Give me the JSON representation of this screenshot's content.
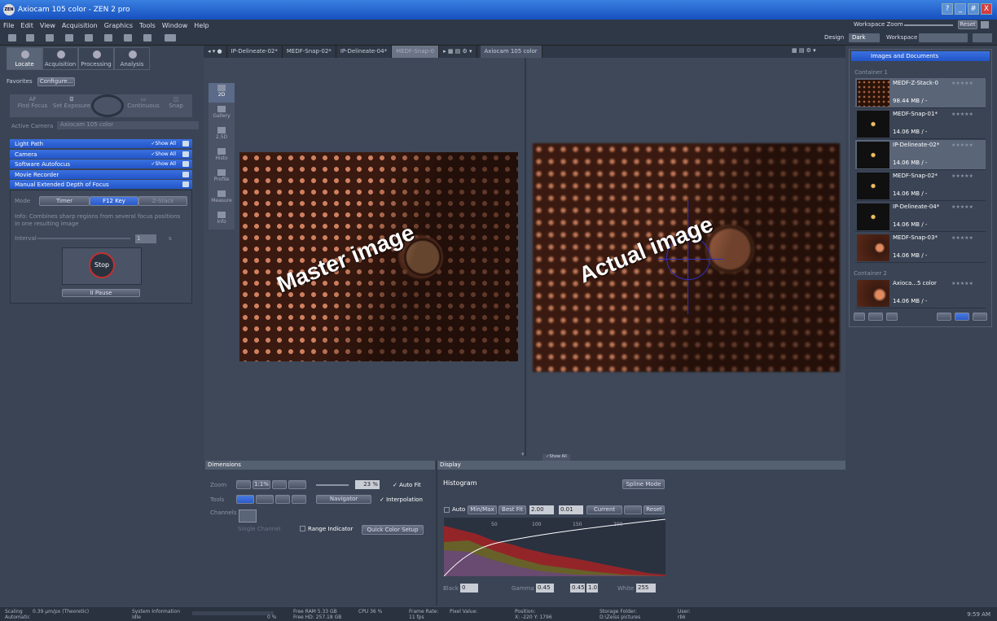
{
  "app": {
    "title": "Axiocam 105 color - ZEN 2 pro",
    "logo": "ZEN",
    "window_buttons": [
      "?",
      "_",
      "#",
      "X"
    ]
  },
  "menu": [
    "File",
    "Edit",
    "View",
    "Acquisition",
    "Graphics",
    "Tools",
    "Window",
    "Help"
  ],
  "top_right": {
    "workspace_zoom": "Workspace Zoom",
    "reset": "Reset",
    "design_label": "Design",
    "design_value": "Dark",
    "workspace_label": "Workspace"
  },
  "left": {
    "tabs": [
      "Locate",
      "Acquisition",
      "Processing",
      "Analysis"
    ],
    "favorites": "Favorites",
    "configure": "Configure...",
    "acq_buttons": [
      {
        "icon": "AF",
        "label": "Find Focus"
      },
      {
        "label": "Set Exposure"
      },
      {
        "label": "Continuous"
      },
      {
        "label": "Snap"
      }
    ],
    "active_camera_label": "Active Camera",
    "active_camera": "Axiocam 105 color",
    "sections": [
      {
        "label": "Light Path",
        "show_all": "✓Show All"
      },
      {
        "label": "Camera",
        "show_all": "✓Show All"
      },
      {
        "label": "Software Autofocus",
        "show_all": "✓Show All"
      },
      {
        "label": "Movie Recorder"
      },
      {
        "label": "Manual Extended Depth of Focus"
      }
    ],
    "mode_label": "Mode",
    "modes": [
      "Timer",
      "F12 Key",
      "Z-Stack"
    ],
    "info": "Info: Combines sharp regions from several focus positions in one resulting image",
    "interval_label": "Interval",
    "interval_value": "1",
    "interval_unit": "s",
    "stop": "Stop",
    "pause": "II Pause"
  },
  "image_tabs": [
    "IP-Delineate-02*",
    "MEDF-Snap-02*",
    "IP-Delineate-04*",
    "MEDF-Snap-0"
  ],
  "camera_tab": "Axiocam 105 color",
  "view_tools": [
    "2D",
    "Gallery",
    "2.5D",
    "Histo",
    "Profile",
    "Measure",
    "Info"
  ],
  "overlays": {
    "master": "Master image",
    "actual": "Actual image"
  },
  "show_all": "✓Show All",
  "right": {
    "header": "Images and Documents",
    "container1": "Container 1",
    "container2": "Container 2",
    "items": [
      {
        "name": "MEDF-Z-Stack-0",
        "size": "98.44 MB / -"
      },
      {
        "name": "MEDF-Snap-01*",
        "size": "14.06 MB / -"
      },
      {
        "name": "IP-Delineate-02*",
        "size": "14.06 MB / -"
      },
      {
        "name": "MEDF-Snap-02*",
        "size": "14.06 MB / -"
      },
      {
        "name": "IP-Delineate-04*",
        "size": "14.06 MB / -"
      },
      {
        "name": "MEDF-Snap-03*",
        "size": "14.06 MB / -"
      }
    ],
    "item_c2": {
      "name": "Axioca...5 color",
      "size": "14.06 MB / -"
    },
    "stars": "★★★★★"
  },
  "dimensions": {
    "title": "Dimensions",
    "zoom_label": "Zoom",
    "zoom_value": "23 %",
    "auto_fit": "✓ Auto Fit",
    "tools_label": "Tools",
    "navigator": "Navigator",
    "interpolation": "✓ Interpolation",
    "channels_label": "Channels",
    "single_channel": "Single Channel",
    "range_indicator": "Range Indicator",
    "quick_color": "Quick Color Setup",
    "zoom_btn": "1:1%"
  },
  "display": {
    "title": "Display",
    "histogram": "Histogram",
    "spline": "Spline Mode",
    "auto": "Auto",
    "minmax": "Min/Max",
    "bestfit": "Best Fit",
    "v1": "2.00",
    "v2": "0.01",
    "current": "Current",
    "reset": "Reset",
    "black_label": "Black",
    "black": "0",
    "gamma_label": "Gamma",
    "gamma": "0.45",
    "gamma2": "0.45",
    "gamma3": "1.0",
    "white_label": "White",
    "white": "255",
    "ticks": [
      "50",
      "100",
      "150",
      "200"
    ]
  },
  "status": {
    "scaling": "Scaling",
    "scaling_val": "0.39 µm/px (Theoretic)",
    "automatic": "Automatic",
    "sysinfo": "System Information",
    "idle": "Idle",
    "pct": "0 %",
    "ram": "Free RAM 5.33 GB",
    "hd": "Free HD: 257.18 GB",
    "cpu": "CPU 36 %",
    "frame_rate": "Frame Rate:",
    "fps": "11 fps",
    "pixel": "Pixel Value:",
    "position": "Position:",
    "pos_val": "X: -220  Y: 1796",
    "storage": "Storage Folder:",
    "storage_val": "D:\\Zeiss pictures",
    "user": "User:",
    "user_val": "rbk",
    "time": "9:59 AM"
  }
}
